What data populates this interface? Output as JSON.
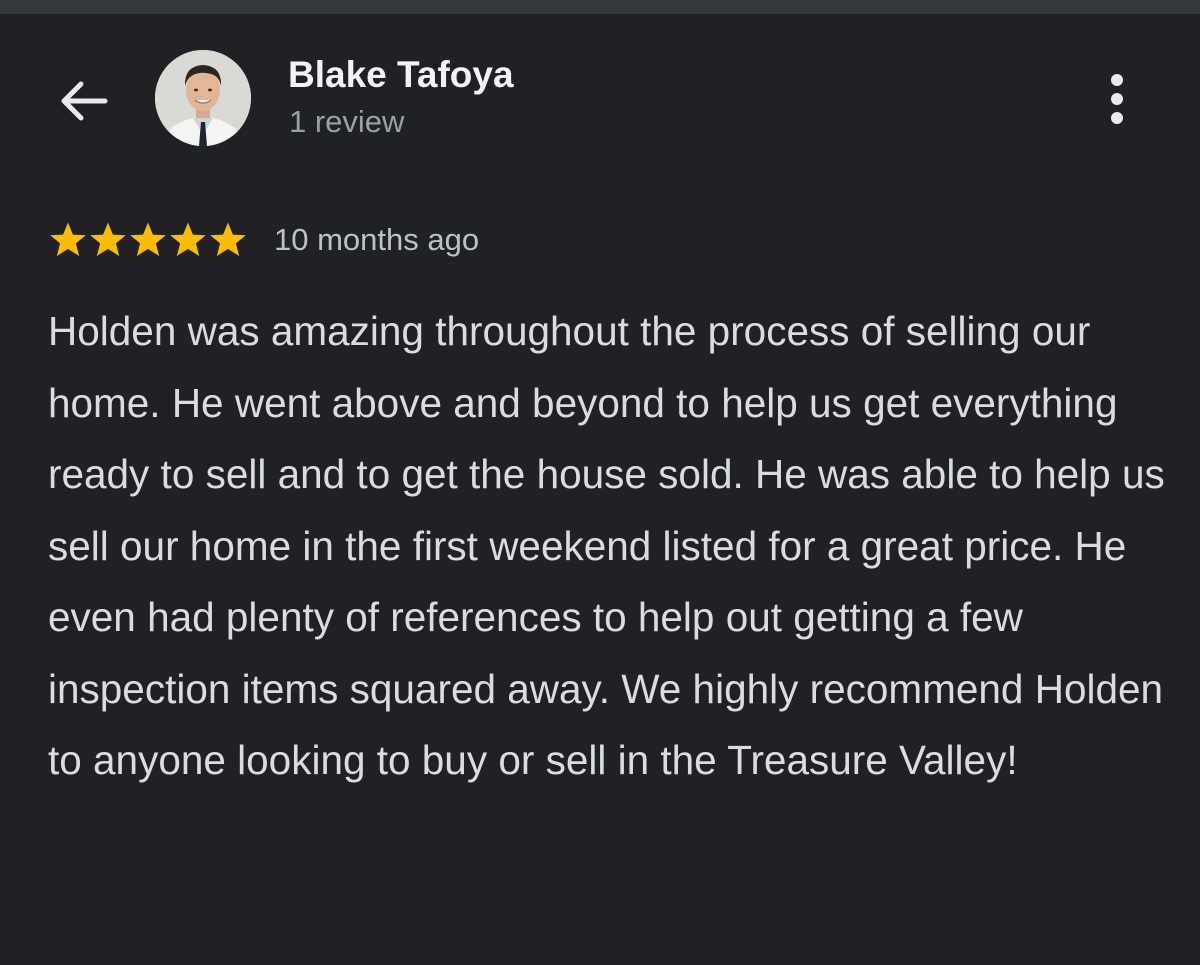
{
  "header": {
    "back_icon": "arrow-back-icon",
    "avatar_icon": "user-avatar-photo",
    "user_name": "Blake Tafoya",
    "review_count": "1 review",
    "more_icon": "more-vert-icon"
  },
  "review": {
    "rating": 5,
    "rating_max": 5,
    "star_color": "#fbbc04",
    "time_ago": "10 months ago",
    "text": "Holden was amazing throughout the process of selling our home. He went above and beyond to help us get everything ready to sell and to get the house sold. He was able to help us sell our home in the first weekend listed for a great price. He even had plenty of references to help out getting a few inspection items squared away. We highly recommend Holden to anyone looking to buy or sell in the Treasure Valley!"
  },
  "theme": {
    "background": "#202124",
    "top_bar": "#34383d",
    "primary_text": "#f1f3f4",
    "secondary_text": "#9aa0a6"
  }
}
